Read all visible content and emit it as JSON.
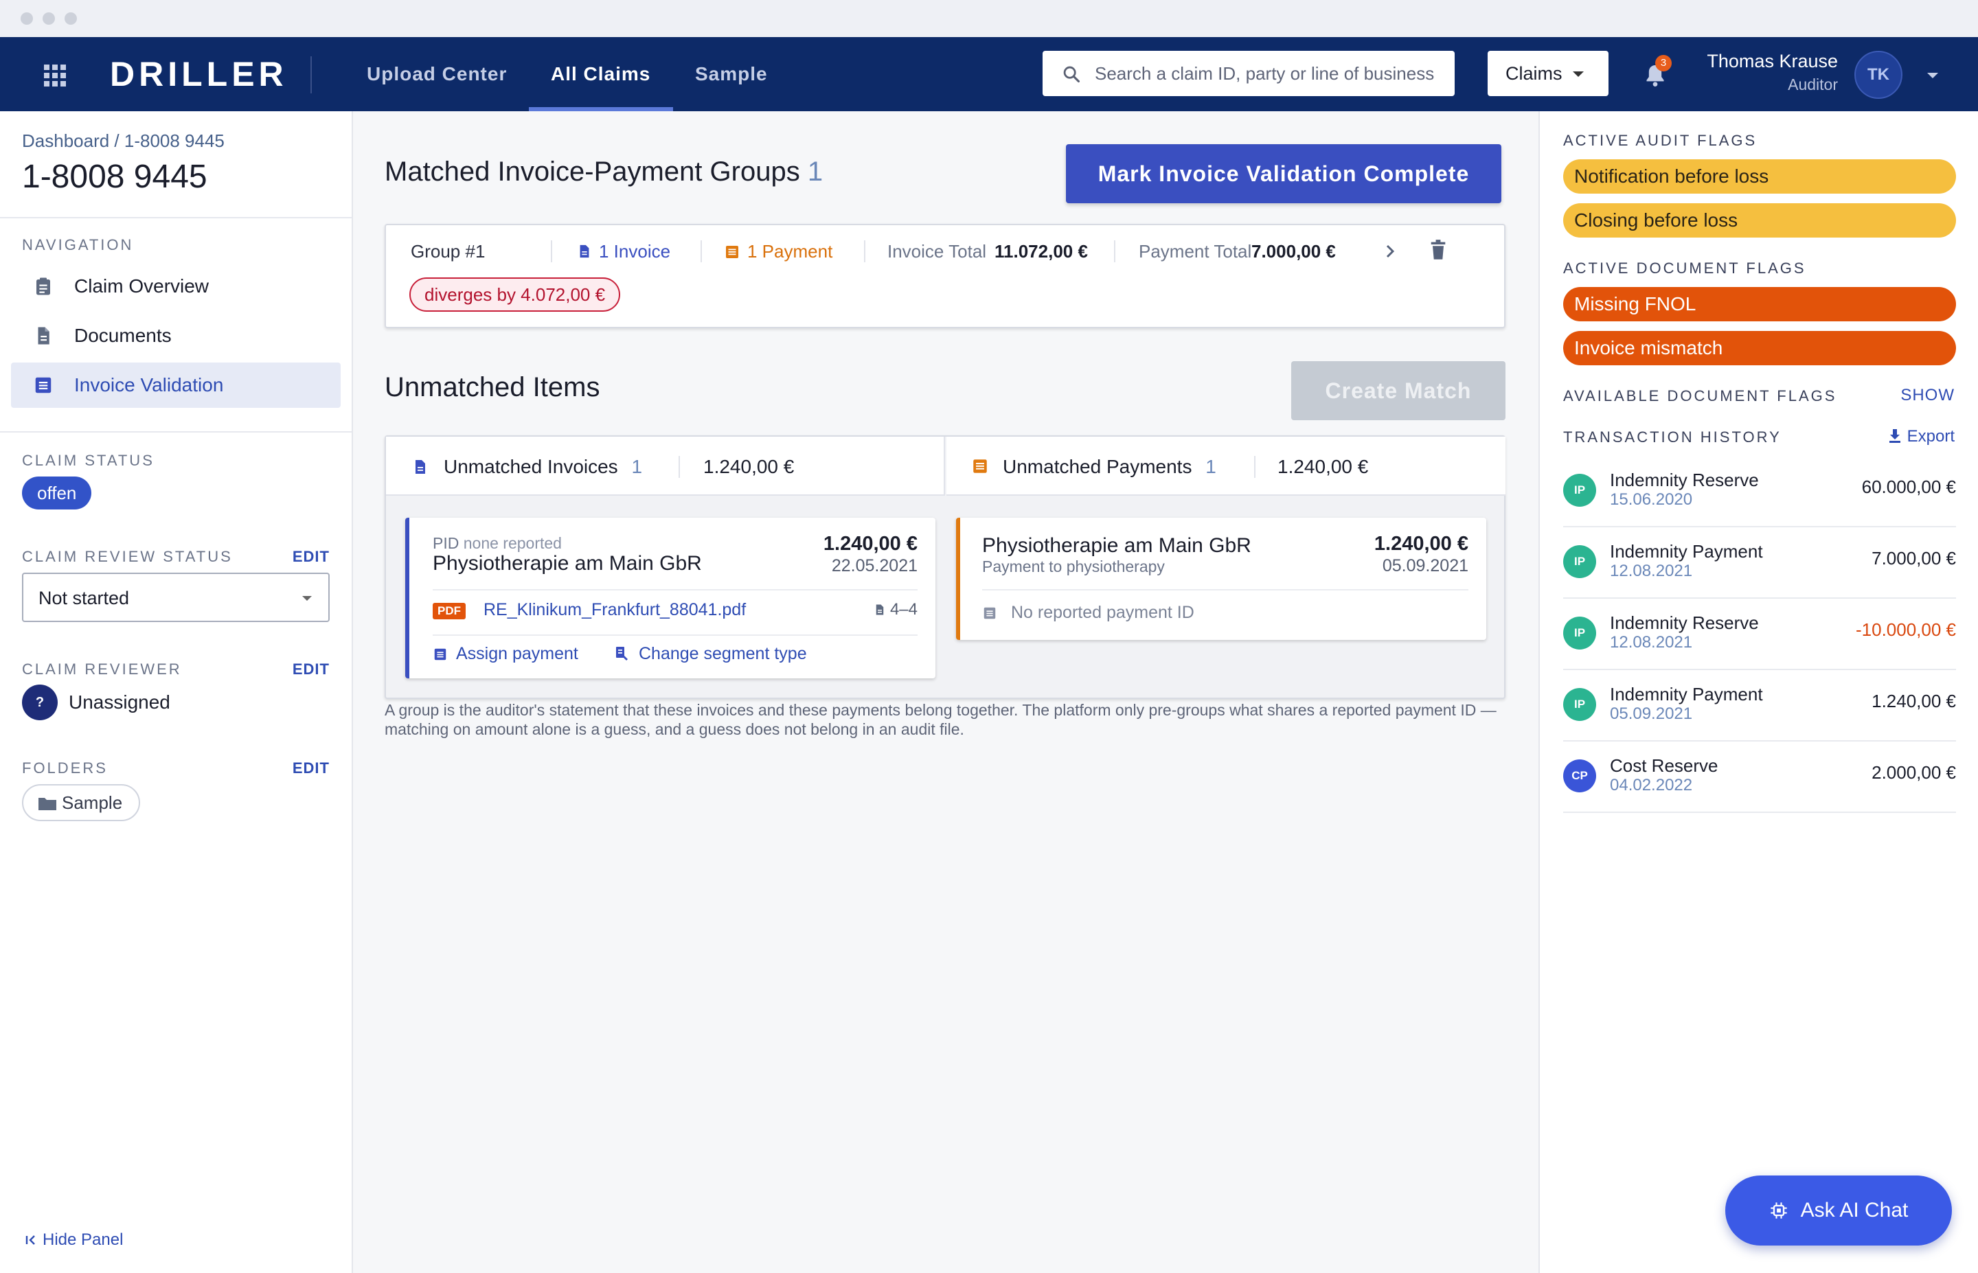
{
  "app": {
    "brand": "DRILLER"
  },
  "topnav": {
    "tabs": [
      "Upload Center",
      "All Claims",
      "Sample"
    ],
    "active_tab": "All Claims",
    "search_placeholder": "Search a claim ID, party or line of business",
    "scope_select": "Claims",
    "notification_count": "3",
    "user": {
      "name": "Thomas Krause",
      "role": "Auditor",
      "initials": "TK"
    }
  },
  "sidebar": {
    "breadcrumb": "Dashboard / 1-8008 9445",
    "claim_id": "1-8008 9445",
    "navigation_label": "NAVIGATION",
    "items": [
      {
        "label": "Claim Overview",
        "icon": "clipboard-icon"
      },
      {
        "label": "Documents",
        "icon": "document-icon"
      },
      {
        "label": "Invoice Validation",
        "icon": "list-icon",
        "active": true
      }
    ],
    "claim_status_label": "CLAIM STATUS",
    "claim_status": "offen",
    "review_status_label": "CLAIM REVIEW STATUS",
    "review_status": "Not started",
    "reviewer_label": "CLAIM REVIEWER",
    "reviewer_initial": "?",
    "reviewer": "Unassigned",
    "folders_label": "FOLDERS",
    "folder": "Sample",
    "edit_label": "EDIT",
    "hide_panel": "Hide Panel"
  },
  "main": {
    "groups_title": "Matched Invoice-Payment Groups",
    "groups_count": "1",
    "mark_complete": "Mark Invoice Validation Complete",
    "group": {
      "name": "Group #1",
      "invoices": "1 Invoice",
      "payments": "1 Payment",
      "invoice_total_label": "Invoice Total",
      "invoice_total": "11.072,00 €",
      "payment_total_label": "Payment Total",
      "payment_total": "7.000,00 €",
      "divergence": "diverges by 4.072,00 €"
    },
    "unmatched_title": "Unmatched Items",
    "create_match": "Create Match",
    "unmatched_invoices": {
      "label": "Unmatched Invoices",
      "count": "1",
      "total": "1.240,00 €"
    },
    "unmatched_payments": {
      "label": "Unmatched Payments",
      "count": "1",
      "total": "1.240,00 €"
    },
    "invoice_card": {
      "pid_label": "PID",
      "pid_value": "none reported",
      "party": "Physiotherapie am Main GbR",
      "amount": "1.240,00 €",
      "date": "22.05.2021",
      "file_badge": "PDF",
      "file": "RE_Klinikum_Frankfurt_88041.pdf",
      "pages": "4–4",
      "assign": "Assign payment",
      "change_segment": "Change segment type"
    },
    "payment_card": {
      "party": "Physiotherapie am Main GbR",
      "description": "Payment to physiotherapy",
      "amount": "1.240,00 €",
      "date": "05.09.2021",
      "payment_id": "No reported payment ID"
    },
    "note": "A group is the auditor's statement that these invoices and these payments belong together. The platform only pre-groups what shares a reported payment ID — matching on amount alone is a guess, and a guess does not belong in an audit file."
  },
  "rightpanel": {
    "audit_flags_label": "ACTIVE AUDIT FLAGS",
    "audit_flags": [
      "Notification before loss",
      "Closing before loss"
    ],
    "doc_flags_label": "ACTIVE DOCUMENT FLAGS",
    "doc_flags": [
      "Missing FNOL",
      "Invoice mismatch"
    ],
    "available_label": "AVAILABLE DOCUMENT FLAGS",
    "show": "SHOW",
    "history_label": "TRANSACTION HISTORY",
    "export": "Export",
    "transactions": [
      {
        "code": "IP",
        "type": "Indemnity Reserve",
        "date": "15.06.2020",
        "amount": "60.000,00 €"
      },
      {
        "code": "IP",
        "type": "Indemnity Payment",
        "date": "12.08.2021",
        "amount": "7.000,00 €"
      },
      {
        "code": "IP",
        "type": "Indemnity Reserve",
        "date": "12.08.2021",
        "amount": "-10.000,00 €"
      },
      {
        "code": "IP",
        "type": "Indemnity Payment",
        "date": "05.09.2021",
        "amount": "1.240,00 €"
      },
      {
        "code": "CP",
        "type": "Cost Reserve",
        "date": "04.02.2022",
        "amount": "2.000,00 €"
      }
    ]
  },
  "ai_chat": "Ask AI Chat",
  "colors": {
    "topbar": "#0d2a68",
    "accent": "#3a4fc0",
    "audit_flag": "#f5bf3f",
    "doc_flag": "#e2530a",
    "negative": "#d9480f",
    "ip_avatar": "#2bb491",
    "cp_avatar": "#3a55d8"
  }
}
